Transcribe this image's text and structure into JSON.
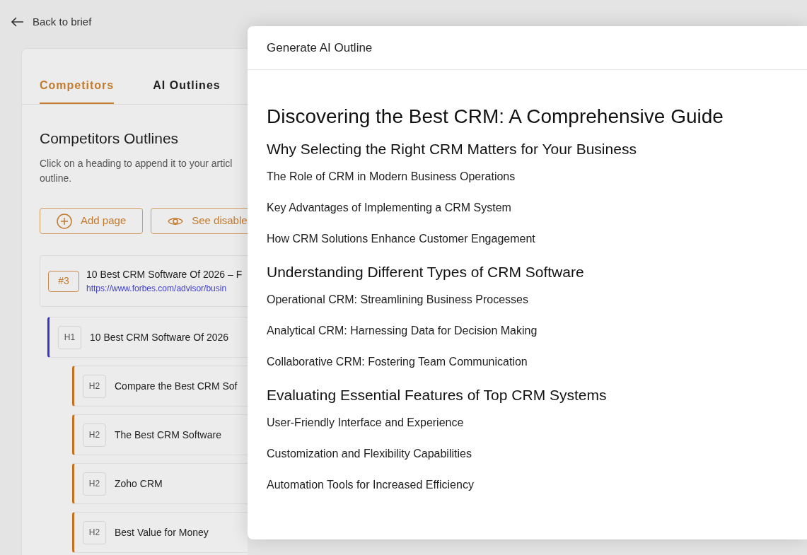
{
  "back_link": "Back to brief",
  "tabs": [
    {
      "label": "Competitors",
      "selected": true
    },
    {
      "label": "AI Outlines",
      "selected": false
    }
  ],
  "competitors": {
    "title": "Competitors Outlines",
    "description_lines": [
      "Click on a heading to append it to your articl",
      "outline."
    ],
    "buttons": [
      {
        "kind": "add",
        "label": "Add page"
      },
      {
        "kind": "view",
        "label": "See disable"
      }
    ],
    "source": {
      "rank": "#3",
      "title": "10 Best CRM Software Of 2026 – F",
      "url": "https://www.forbes.com/advisor/busin"
    },
    "headings": [
      {
        "level": "H1",
        "text": "10 Best CRM Software Of 2026",
        "children": [
          {
            "level": "H2",
            "text": "Compare the Best CRM Sof"
          },
          {
            "level": "H2",
            "text": "The Best CRM Software"
          },
          {
            "level": "H2",
            "text": "Zoho CRM"
          },
          {
            "level": "H2",
            "text": "Best Value for Money"
          }
        ]
      }
    ]
  },
  "drawer": {
    "title": "Generate AI Outline",
    "outline": [
      {
        "kind": "h1",
        "text": "Discovering the Best CRM: A Comprehensive Guide"
      },
      {
        "kind": "h2",
        "text": "Why Selecting the Right CRM Matters for Your Business"
      },
      {
        "kind": "h3",
        "text": "The Role of CRM in Modern Business Operations"
      },
      {
        "kind": "h3",
        "text": "Key Advantages of Implementing a CRM System"
      },
      {
        "kind": "h3",
        "text": "How CRM Solutions Enhance Customer Engagement"
      },
      {
        "kind": "h2",
        "text": "Understanding Different Types of CRM Software"
      },
      {
        "kind": "h3",
        "text": "Operational CRM: Streamlining Business Processes"
      },
      {
        "kind": "h3",
        "text": "Analytical CRM: Harnessing Data for Decision Making"
      },
      {
        "kind": "h3",
        "text": "Collaborative CRM: Fostering Team Communication"
      },
      {
        "kind": "h2",
        "text": "Evaluating Essential Features of Top CRM Systems"
      },
      {
        "kind": "h3",
        "text": "User-Friendly Interface and Experience"
      },
      {
        "kind": "h3",
        "text": "Customization and Flexibility Capabilities"
      },
      {
        "kind": "h3",
        "text": "Automation Tools for Increased Efficiency"
      }
    ]
  }
}
